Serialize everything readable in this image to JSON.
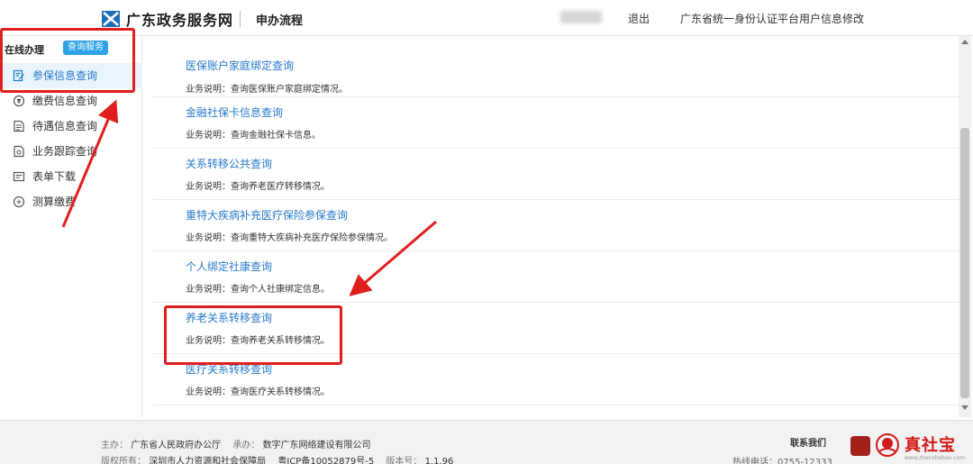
{
  "header": {
    "site_title": "广东政务服务网",
    "page_name": "申办流程",
    "logout": "退出",
    "profile_edit": "广东省统一身份认证平台用户信息修改"
  },
  "sidebar": {
    "title": "在线办理",
    "tag": "查询服务",
    "items": [
      {
        "label": "参保信息查询",
        "icon": "document-edit-icon",
        "active": true
      },
      {
        "label": "缴费信息查询",
        "icon": "coin-icon",
        "active": false
      },
      {
        "label": "待遇信息查询",
        "icon": "document-icon",
        "active": false
      },
      {
        "label": "业务跟踪查询",
        "icon": "track-icon",
        "active": false
      },
      {
        "label": "表单下载",
        "icon": "form-icon",
        "active": false
      },
      {
        "label": "测算缴费",
        "icon": "calculator-icon",
        "active": false
      }
    ]
  },
  "services": [
    {
      "title": "医保账户家庭绑定查询",
      "desc": "业务说明：查询医保账户家庭绑定情况。"
    },
    {
      "title": "金融社保卡信息查询",
      "desc": "业务说明：查询金融社保卡信息。"
    },
    {
      "title": "关系转移公共查询",
      "desc": "业务说明：查询养老医疗转移情况。"
    },
    {
      "title": "重特大疾病补充医疗保险参保查询",
      "desc": "业务说明：查询重特大疾病补充医疗保险参保情况。"
    },
    {
      "title": "个人绑定社康查询",
      "desc": "业务说明：查询个人社康绑定信息。"
    },
    {
      "title": "养老关系转移查询",
      "desc": "业务说明：查询养老关系转移情况。"
    },
    {
      "title": "医疗关系转移查询",
      "desc": "业务说明：查询医疗关系转移情况。"
    }
  ],
  "footer": {
    "host_label": "主办：",
    "host": "广东省人民政府办公厅",
    "undertake_label": "承办：",
    "undertake": "数字广东网络建设有限公司",
    "copyright_label": "版权所有：",
    "copyright": "深圳市人力资源和社会保障局",
    "icp": "粤ICP备10052879号-5",
    "version_label": "版本号：",
    "version": "1.1.96",
    "contact": "联系我们",
    "hotline": "热线电话：0755-12333",
    "brand_name": "真社宝",
    "brand_url": "www.zhenshebao.com"
  },
  "colors": {
    "accent": "#2979c9",
    "tag": "#2ea2e6",
    "annotation": "#e11e1e",
    "brand": "#d11a1a"
  }
}
